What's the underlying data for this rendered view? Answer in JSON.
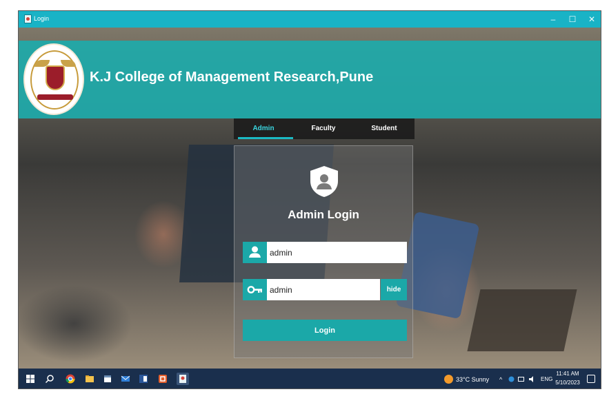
{
  "window": {
    "title": "Login",
    "minimize_glyph": "–",
    "maximize_glyph": "☐",
    "close_glyph": "✕"
  },
  "header": {
    "college_name": "K.J College of Management Research,Pune"
  },
  "tabs": [
    {
      "label": "Admin",
      "active": true
    },
    {
      "label": "Faculty",
      "active": false
    },
    {
      "label": "Student",
      "active": false
    }
  ],
  "login": {
    "title": "Admin Login",
    "username_value": "admin",
    "password_value": "admin",
    "hide_label": "hide",
    "login_label": "Login",
    "icons": {
      "user": "user-icon",
      "password": "key-icon",
      "panel": "shield-user-icon"
    }
  },
  "taskbar": {
    "weather": "33°C  Sunny",
    "tray_glyphs": "^",
    "language": "ENG",
    "time": "11:41 AM",
    "date": "5/10/2023"
  },
  "colors": {
    "accent": "#1ba8a8",
    "titlebar": "#19b3c6",
    "taskbar": "#1a2f4d"
  }
}
